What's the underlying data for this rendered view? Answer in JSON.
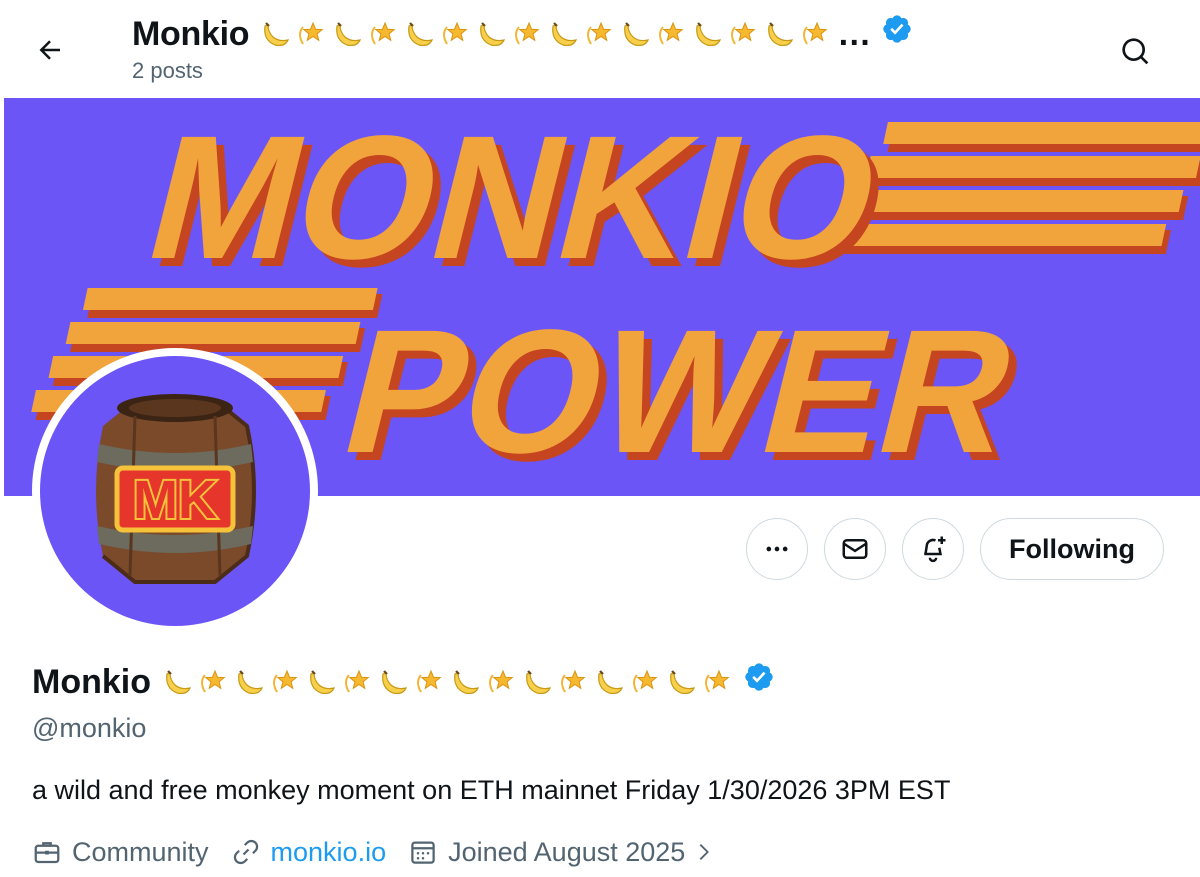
{
  "header": {
    "name": "Monkio",
    "posts_count": "2 posts",
    "name_ellipsis": "…"
  },
  "banner": {
    "line1": "MONKIO",
    "line2": "POWER",
    "colors": {
      "background": "#6c55f7",
      "text": "#f1a33c",
      "shadow": "#c4451f"
    }
  },
  "avatar": {
    "label": "MK",
    "icon": "barrel-icon"
  },
  "actions": {
    "more_icon": "more-icon",
    "message_icon": "mail-icon",
    "notify_icon": "bell-plus-icon",
    "following_label": "Following"
  },
  "profile": {
    "display_name": "Monkio",
    "handle": "@monkio",
    "bio": "a wild and free monkey moment on ETH mainnet Friday 1/30/2026 3PM EST",
    "category": "Community",
    "website": "monkio.io",
    "joined": "Joined August 2025",
    "verified_color": "#1d9bf0"
  }
}
